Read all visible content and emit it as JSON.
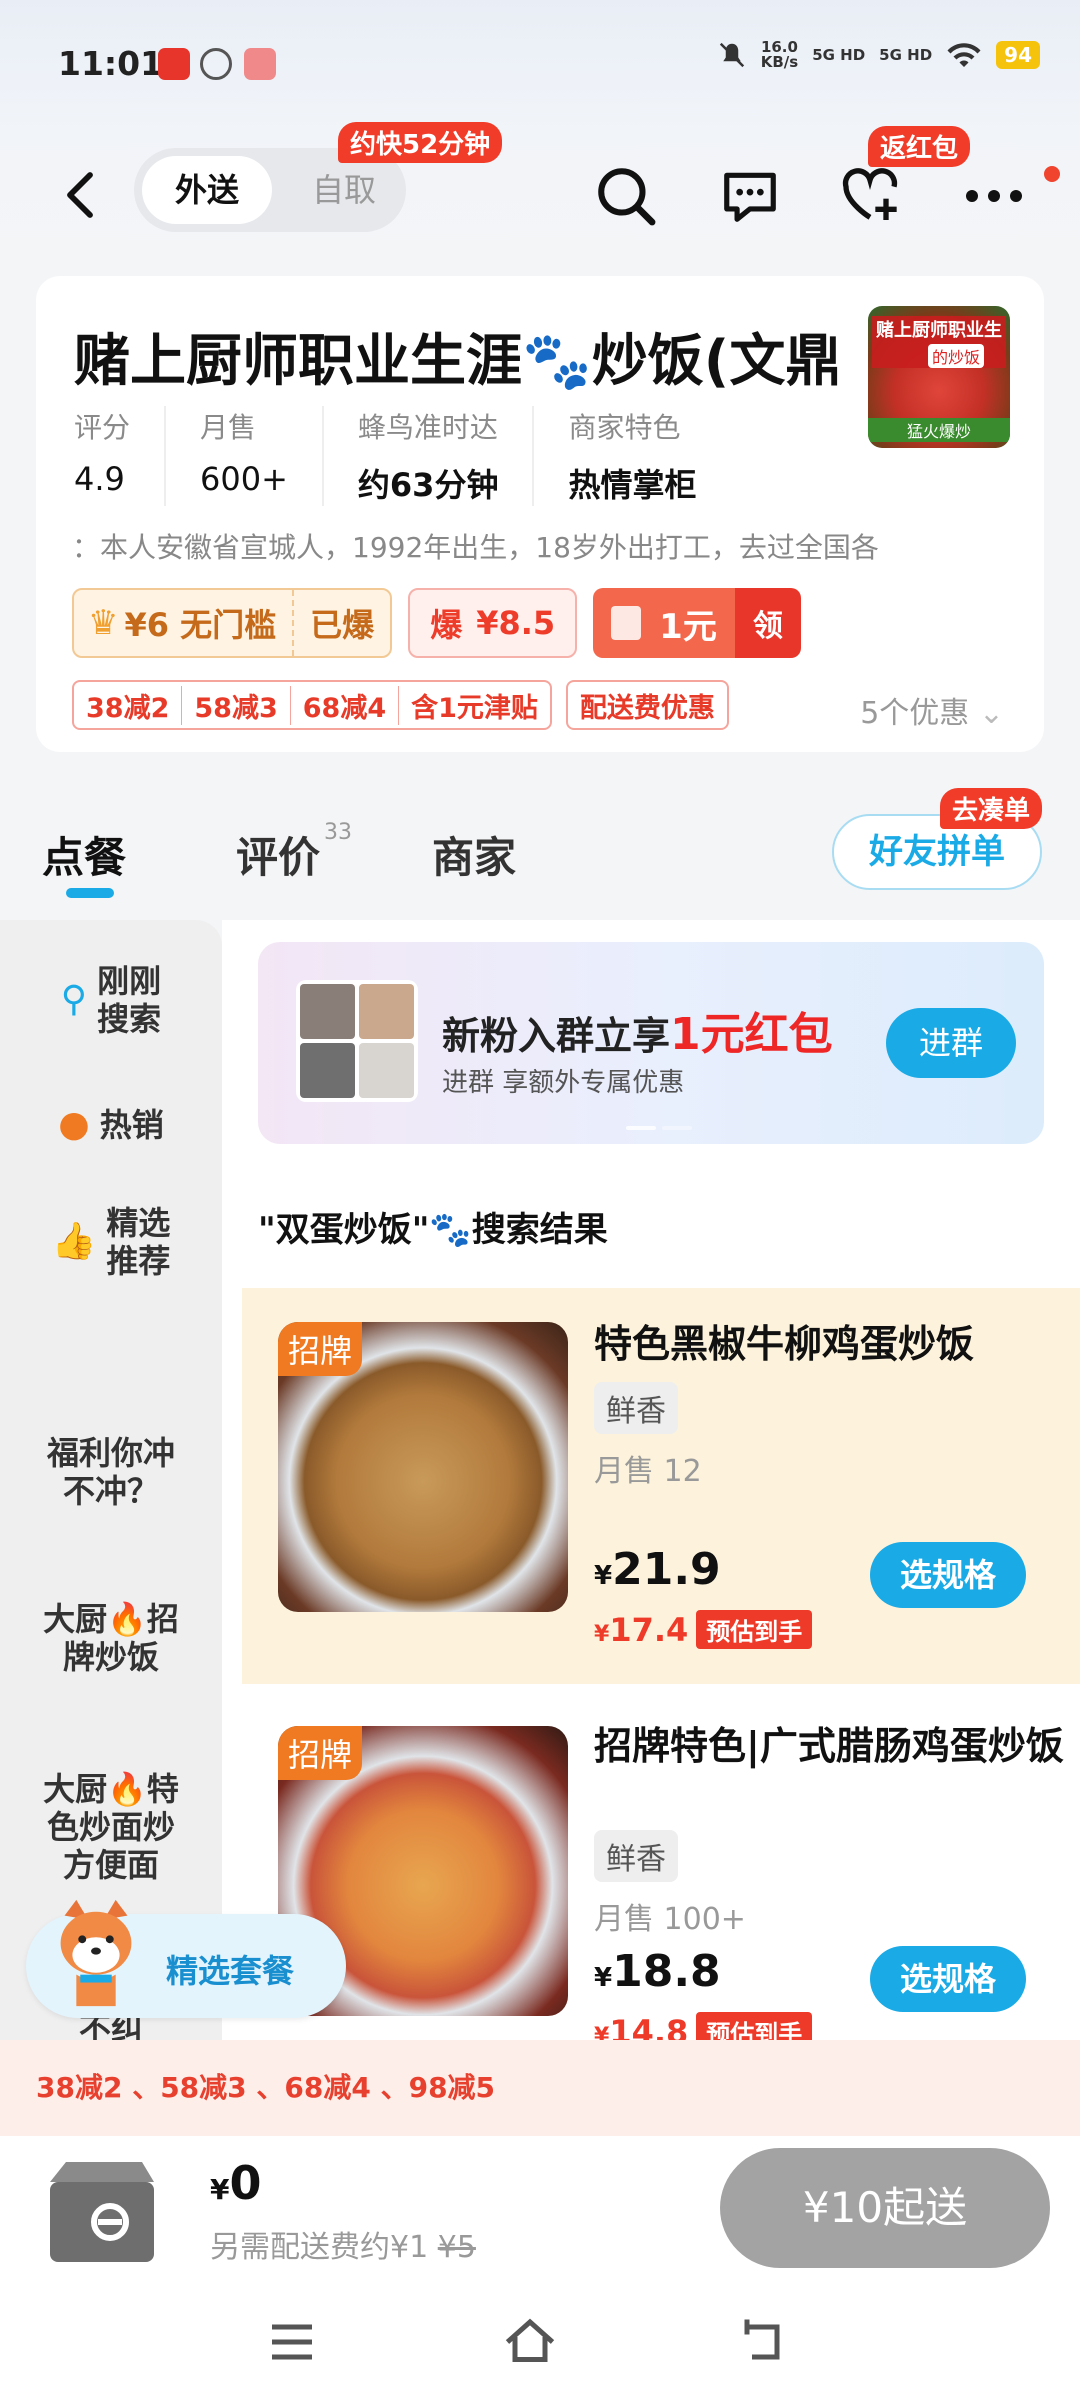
{
  "status_bar": {
    "time": "11:01",
    "net_speed": "16.0\nKB/s",
    "signal1": "5G HD",
    "signal2": "5G HD",
    "battery": "94"
  },
  "nav": {
    "tab_delivery": "外送",
    "tab_pickup": "自取",
    "faster_badge": "约快52分钟",
    "redpacket_badge": "返红包"
  },
  "store": {
    "name": "赌上厨师职业生涯🐾炒饭(文鼎",
    "logo_top": "赌上厨师职业生涯",
    "logo_mid": "的炒饭",
    "logo_bottom": "猛火爆炒",
    "stats": [
      {
        "k": "评分",
        "v": "4.9"
      },
      {
        "k": "月售",
        "v": "600+"
      },
      {
        "k": "蜂鸟准时达",
        "v": "约63分钟"
      },
      {
        "k": "商家特色",
        "v": "热情掌柜"
      }
    ],
    "intro": "：本人安徽省宣城人，1992年出生，18岁外出打工，去过全国各",
    "coupon1_a": "¥6 无门槛",
    "coupon1_b": "已爆",
    "coupon2_a": "爆",
    "coupon2_b": "¥8.5",
    "coupon3_a": "1元",
    "coupon3_b": "领",
    "promos": [
      "38减2",
      "58减3",
      "68减4",
      "含1元津贴"
    ],
    "delivery_promo": "配送费优惠",
    "more_promo": "5个优惠"
  },
  "tabs": {
    "order": "点餐",
    "review": "评价",
    "review_count": "33",
    "merchant": "商家",
    "friend_badge": "去凑单",
    "friend_button": "好友拼单"
  },
  "sidebar": [
    {
      "label": "刚刚\n搜索"
    },
    {
      "label": "热销"
    },
    {
      "label": "精选\n推荐"
    },
    {
      "label": "福利你冲\n不冲？"
    },
    {
      "label": "大厨🔥招\n牌炒饭"
    },
    {
      "label": "大厨🔥特\n色炒面炒\n方便面"
    },
    {
      "label": "不纠"
    }
  ],
  "banner": {
    "title_a": "新粉入群立享",
    "title_b": "1元红包",
    "subtitle": "进群 享额外专属优惠",
    "join": "进群"
  },
  "search_title": "\"双蛋炒饭\"🐾搜索结果",
  "dishes": [
    {
      "badge": "招牌",
      "name": "特色黑椒牛柳鸡蛋炒饭",
      "flavor": "鲜香",
      "sales": "月售 12",
      "price": "21.9",
      "est": "17.4",
      "est_tag": "预估到手",
      "spec": "选规格"
    },
    {
      "badge": "招牌",
      "name": "招牌特色|广式腊肠鸡蛋炒饭",
      "flavor": "鲜香",
      "sales": "月售 100+",
      "price": "18.8",
      "est": "14.8",
      "est_tag": "预估到手",
      "spec": "选规格"
    }
  ],
  "combo": "精选套餐",
  "strip": "38减2 、58减3 、68减4 、98减5",
  "cart": {
    "amount": "0",
    "fee": "另需配送费约¥1",
    "fee_old": "¥5",
    "go": "¥10起送"
  },
  "colors": {
    "accent": "#1aaae6",
    "red": "#ee3a28",
    "orange": "#f07a22"
  }
}
